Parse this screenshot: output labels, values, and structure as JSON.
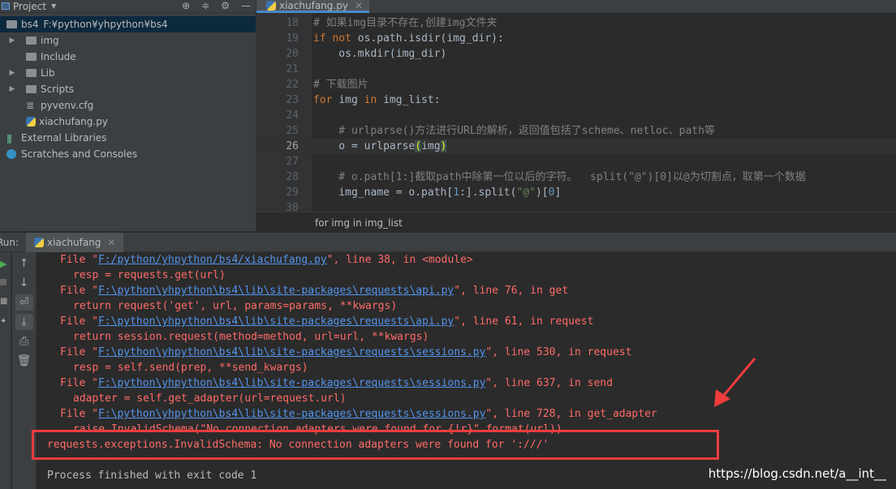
{
  "project_panel": {
    "title": "Project",
    "root": {
      "name": "bs4",
      "path": "F:¥python¥yhpython¥bs4"
    },
    "items": [
      {
        "label": "img",
        "type": "folder",
        "expandable": true
      },
      {
        "label": "Include",
        "type": "folder",
        "expandable": false
      },
      {
        "label": "Lib",
        "type": "folder",
        "expandable": true
      },
      {
        "label": "Scripts",
        "type": "folder",
        "expandable": true
      },
      {
        "label": "pyvenv.cfg",
        "type": "file"
      },
      {
        "label": "xiachufang.py",
        "type": "python-file"
      }
    ],
    "external_libraries": "External Libraries",
    "scratches": "Scratches and Consoles"
  },
  "editor": {
    "tab": "xiachufang.py",
    "current_line": 26,
    "lines": [
      {
        "n": "18",
        "seg": [
          [
            "# 如果img目录不存在,创建img文件夹",
            "cm"
          ]
        ]
      },
      {
        "n": "19",
        "seg": [
          [
            "if not ",
            "kw"
          ],
          [
            "os.path.isdir(img_dir):",
            ""
          ]
        ]
      },
      {
        "n": "20",
        "seg": [
          [
            "    os.mkdir(img_dir)",
            ""
          ]
        ]
      },
      {
        "n": "21",
        "seg": []
      },
      {
        "n": "22",
        "seg": [
          [
            "# 下载图片",
            "cm"
          ]
        ]
      },
      {
        "n": "23",
        "seg": [
          [
            "for ",
            "kw"
          ],
          [
            "img ",
            ""
          ],
          [
            "in ",
            "kw"
          ],
          [
            "img_list:",
            ""
          ]
        ]
      },
      {
        "n": "24",
        "seg": []
      },
      {
        "n": "25",
        "seg": [
          [
            "    # urlparse()方法进行URL的解析，返回值包括了scheme、netloc、path等",
            "cm"
          ]
        ]
      },
      {
        "n": "26",
        "seg": [
          [
            "    o = urlparse",
            ""
          ],
          [
            "(",
            "br"
          ],
          [
            "img",
            ""
          ],
          [
            ")",
            "br"
          ]
        ]
      },
      {
        "n": "27",
        "seg": []
      },
      {
        "n": "28",
        "seg": [
          [
            "    # o.path[1:]截取path中除第一位以后的字符。  split(\"@\")[0]以@为切割点，取第一个数据",
            "cm"
          ]
        ]
      },
      {
        "n": "29",
        "seg": [
          [
            "    img_name = o.path[",
            ""
          ],
          [
            "1",
            "num"
          ],
          [
            ":].split(",
            ""
          ],
          [
            "\"@\"",
            "str"
          ],
          [
            ")[",
            ""
          ],
          [
            "0",
            "num"
          ],
          [
            "]",
            ""
          ]
        ]
      },
      {
        "n": "30",
        "seg": []
      }
    ],
    "breadcrumb": "for img in img_list"
  },
  "run": {
    "label": "Run:",
    "tab": "xiachufang",
    "output": [
      {
        "indent": "  ",
        "pre": "File \"",
        "link": "F:/python/yhpython/bs4/xiachufang.py",
        "post": "\", line 38, in <module>"
      },
      {
        "indent": "    ",
        "pre": "resp = requests.get(url)"
      },
      {
        "indent": "  ",
        "pre": "File \"",
        "link": "F:\\python\\yhpython\\bs4\\lib\\site-packages\\requests\\api.py",
        "post": "\", line 76, in get"
      },
      {
        "indent": "    ",
        "pre": "return request('get', url, params=params, **kwargs)"
      },
      {
        "indent": "  ",
        "pre": "File \"",
        "link": "F:\\python\\yhpython\\bs4\\lib\\site-packages\\requests\\api.py",
        "post": "\", line 61, in request"
      },
      {
        "indent": "    ",
        "pre": "return session.request(method=method, url=url, **kwargs)"
      },
      {
        "indent": "  ",
        "pre": "File \"",
        "link": "F:\\python\\yhpython\\bs4\\lib\\site-packages\\requests\\sessions.py",
        "post": "\", line 530, in request"
      },
      {
        "indent": "    ",
        "pre": "resp = self.send(prep, **send_kwargs)"
      },
      {
        "indent": "  ",
        "pre": "File \"",
        "link": "F:\\python\\yhpython\\bs4\\lib\\site-packages\\requests\\sessions.py",
        "post": "\", line 637, in send"
      },
      {
        "indent": "    ",
        "pre": "adapter = self.get_adapter(url=request.url)"
      },
      {
        "indent": "  ",
        "pre": "File \"",
        "link": "F:\\python\\yhpython\\bs4\\lib\\site-packages\\requests\\sessions.py",
        "post": "\", line 728, in get_adapter"
      },
      {
        "indent": "    ",
        "pre": "raise InvalidSchema(\"No connection adapters were found for {!r}\".format(url))"
      },
      {
        "indent": "",
        "pre": "requests.exceptions.InvalidSchema: No connection adapters were found for ':///'"
      },
      {
        "indent": "",
        "pre": ""
      },
      {
        "indent": "",
        "pre": "Process finished with exit code 1",
        "grey": true
      }
    ]
  },
  "watermark": "https://blog.csdn.net/a__int__",
  "colors": {
    "error": "#ff6b68",
    "link": "#5394ec",
    "highlight_box": "#f03c3c",
    "keyword": "#cc7832",
    "comment": "#808080"
  }
}
